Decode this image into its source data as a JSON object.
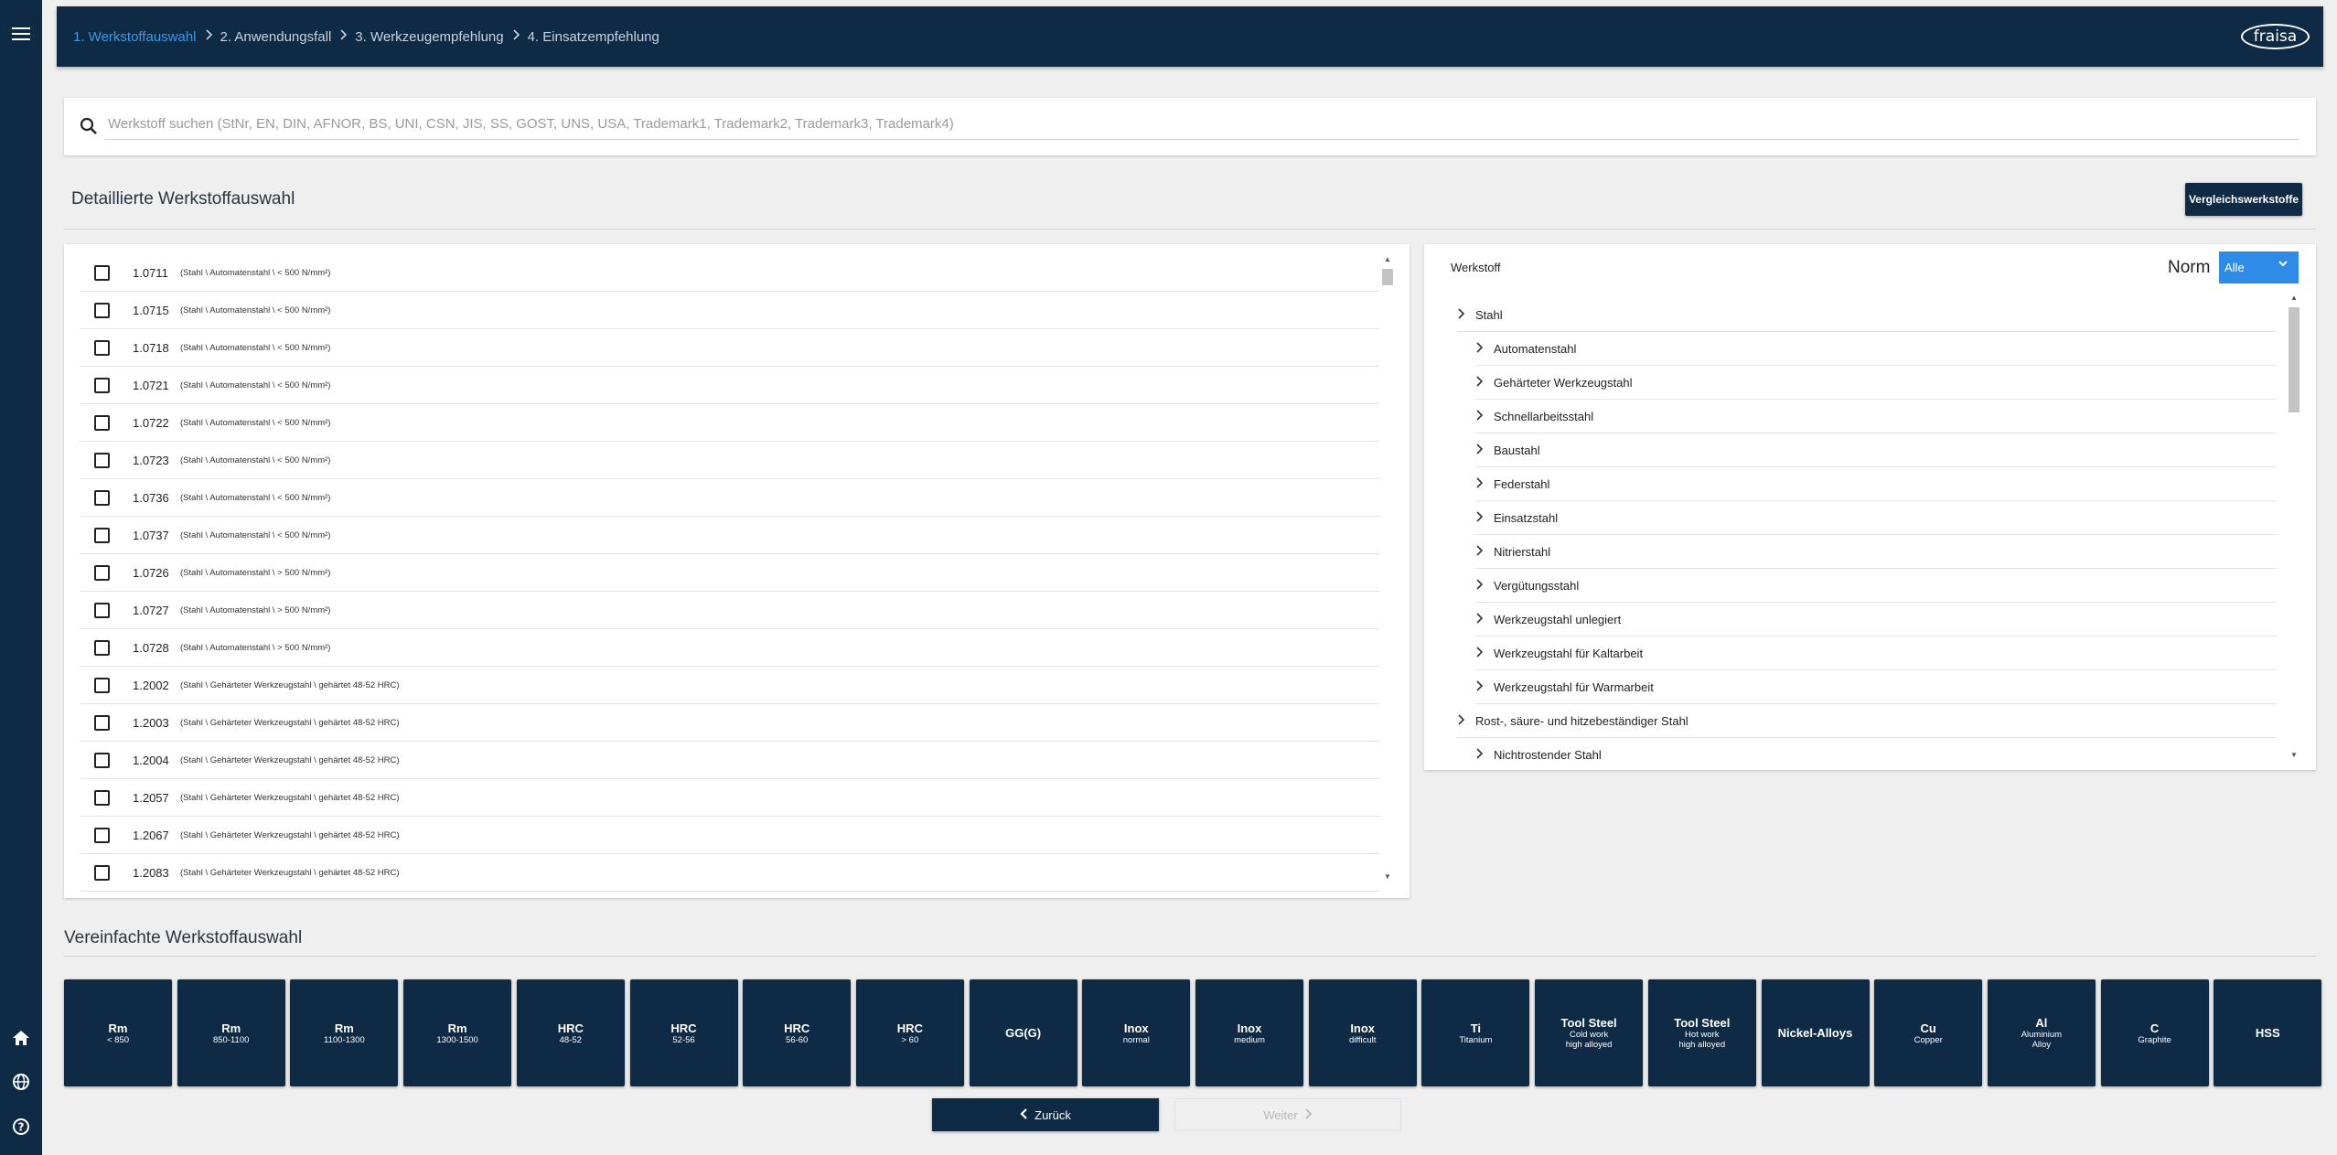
{
  "nav": {
    "steps": [
      {
        "label": "1. Werkstoffauswahl",
        "active": true
      },
      {
        "label": "2. Anwendungsfall",
        "active": false
      },
      {
        "label": "3. Werkzeugempfehlung",
        "active": false
      },
      {
        "label": "4. Einsatzempfehlung",
        "active": false
      }
    ],
    "logo": "fraisa"
  },
  "search": {
    "placeholder": "Werkstoff suchen (StNr, EN, DIN, AFNOR, BS, UNI, CSN, JIS, SS, GOST, UNS, USA, Trademark1, Trademark2, Trademark3, Trademark4)"
  },
  "detail": {
    "title": "Detaillierte Werkstoffauswahl",
    "compare_label": "Vergleichswerkstoffe"
  },
  "materials": [
    {
      "num": "1.0711",
      "path": "(Stahl \\ Automatenstahl \\ < 500 N/mm²)"
    },
    {
      "num": "1.0715",
      "path": "(Stahl \\ Automatenstahl \\ < 500 N/mm²)"
    },
    {
      "num": "1.0718",
      "path": "(Stahl \\ Automatenstahl \\ < 500 N/mm²)"
    },
    {
      "num": "1.0721",
      "path": "(Stahl \\ Automatenstahl \\ < 500 N/mm²)"
    },
    {
      "num": "1.0722",
      "path": "(Stahl \\ Automatenstahl \\ < 500 N/mm²)"
    },
    {
      "num": "1.0723",
      "path": "(Stahl \\ Automatenstahl \\ < 500 N/mm²)"
    },
    {
      "num": "1.0736",
      "path": "(Stahl \\ Automatenstahl \\ < 500 N/mm²)"
    },
    {
      "num": "1.0737",
      "path": "(Stahl \\ Automatenstahl \\ < 500 N/mm²)"
    },
    {
      "num": "1.0726",
      "path": "(Stahl \\ Automatenstahl \\ > 500 N/mm²)"
    },
    {
      "num": "1.0727",
      "path": "(Stahl \\ Automatenstahl \\ > 500 N/mm²)"
    },
    {
      "num": "1.0728",
      "path": "(Stahl \\ Automatenstahl \\ > 500 N/mm²)"
    },
    {
      "num": "1.2002",
      "path": "(Stahl \\ Gehärteter Werkzeugstahl \\ gehärtet 48-52 HRC)"
    },
    {
      "num": "1.2003",
      "path": "(Stahl \\ Gehärteter Werkzeugstahl \\ gehärtet 48-52 HRC)"
    },
    {
      "num": "1.2004",
      "path": "(Stahl \\ Gehärteter Werkzeugstahl \\ gehärtet 48-52 HRC)"
    },
    {
      "num": "1.2057",
      "path": "(Stahl \\ Gehärteter Werkzeugstahl \\ gehärtet 48-52 HRC)"
    },
    {
      "num": "1.2067",
      "path": "(Stahl \\ Gehärteter Werkzeugstahl \\ gehärtet 48-52 HRC)"
    },
    {
      "num": "1.2083",
      "path": "(Stahl \\ Gehärteter Werkzeugstahl \\ gehärtet 48-52 HRC)"
    }
  ],
  "tree": {
    "title": "Werkstoff",
    "norm_label": "Norm",
    "norm_value": "Alle",
    "items": [
      {
        "label": "Stahl",
        "level": 0
      },
      {
        "label": "Automatenstahl",
        "level": 1
      },
      {
        "label": "Gehärteter Werkzeugstahl",
        "level": 1
      },
      {
        "label": "Schnellarbeitsstahl",
        "level": 1
      },
      {
        "label": "Baustahl",
        "level": 1
      },
      {
        "label": "Federstahl",
        "level": 1
      },
      {
        "label": "Einsatzstahl",
        "level": 1
      },
      {
        "label": "Nitrierstahl",
        "level": 1
      },
      {
        "label": "Vergütungsstahl",
        "level": 1
      },
      {
        "label": "Werkzeugstahl unlegiert",
        "level": 1
      },
      {
        "label": "Werkzeugstahl für Kaltarbeit",
        "level": 1
      },
      {
        "label": "Werkzeugstahl für Warmarbeit",
        "level": 1
      },
      {
        "label": "Rost-, säure- und hitzebeständiger Stahl",
        "level": 0
      },
      {
        "label": "Nichtrostender Stahl",
        "level": 1
      }
    ]
  },
  "simple": {
    "title": "Vereinfachte Werkstoffauswahl",
    "tiles": [
      {
        "title": "Rm",
        "sub": [
          "< 850"
        ]
      },
      {
        "title": "Rm",
        "sub": [
          "850-1100"
        ]
      },
      {
        "title": "Rm",
        "sub": [
          "1100-1300"
        ]
      },
      {
        "title": "Rm",
        "sub": [
          "1300-1500"
        ]
      },
      {
        "title": "HRC",
        "sub": [
          "48-52"
        ]
      },
      {
        "title": "HRC",
        "sub": [
          "52-56"
        ]
      },
      {
        "title": "HRC",
        "sub": [
          "56-60"
        ]
      },
      {
        "title": "HRC",
        "sub": [
          "> 60"
        ]
      },
      {
        "title": "GG(G)",
        "sub": []
      },
      {
        "title": "Inox",
        "sub": [
          "normal"
        ]
      },
      {
        "title": "Inox",
        "sub": [
          "medium"
        ]
      },
      {
        "title": "Inox",
        "sub": [
          "difficult"
        ]
      },
      {
        "title": "Ti",
        "sub": [
          "Titanium"
        ]
      },
      {
        "title": "Tool Steel",
        "sub": [
          "Cold work",
          "high alloyed"
        ]
      },
      {
        "title": "Tool Steel",
        "sub": [
          "Hot work",
          "high alloyed"
        ]
      },
      {
        "title": "Nickel-Alloys",
        "sub": []
      },
      {
        "title": "Cu",
        "sub": [
          "Copper"
        ]
      },
      {
        "title": "Al",
        "sub": [
          "Aluminium",
          "Alloy"
        ]
      },
      {
        "title": "C",
        "sub": [
          "Graphite"
        ]
      },
      {
        "title": "HSS",
        "sub": []
      }
    ]
  },
  "buttons": {
    "back": "Zurück",
    "next": "Weiter"
  },
  "colors": {
    "navy": "#0e2a45",
    "accent": "#2e8ce6",
    "active_step": "#3b9ae6"
  }
}
